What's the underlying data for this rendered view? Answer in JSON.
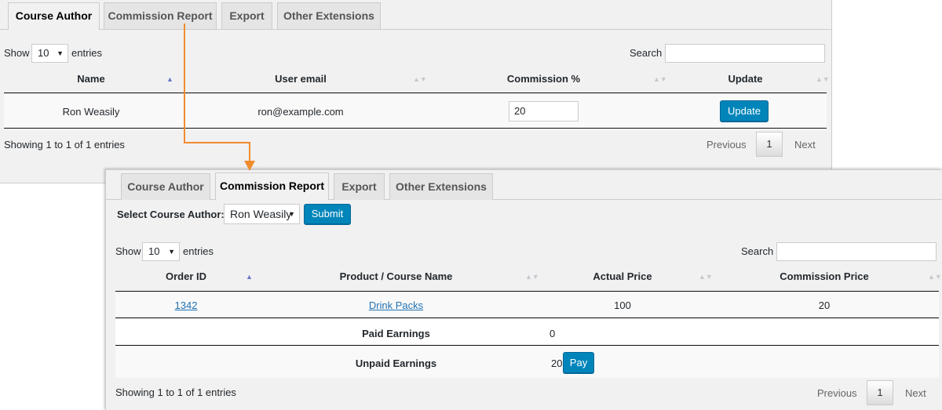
{
  "colors": {
    "accent": "#0085ba",
    "arrow": "#f08c2e",
    "link": "#2271b1"
  },
  "tabs": [
    "Course Author",
    "Commission Report",
    "Export",
    "Other Extensions"
  ],
  "panel1": {
    "active_tab": "Course Author",
    "length": {
      "show": "Show",
      "value": "10",
      "entries": "entries"
    },
    "search_label": "Search",
    "columns": [
      "Name",
      "User email",
      "Commission %",
      "Update"
    ],
    "rows": [
      {
        "name": "Ron Weasily",
        "email": "ron@example.com",
        "commission": "20",
        "update_label": "Update"
      }
    ],
    "info": "Showing 1 to 1 of 1 entries",
    "pagination": {
      "previous": "Previous",
      "current": "1",
      "next": "Next"
    }
  },
  "panel2": {
    "active_tab": "Commission Report",
    "author_label": "Select Course Author:",
    "author_value": "Ron Weasily",
    "submit_label": "Submit",
    "length": {
      "show": "Show",
      "value": "10",
      "entries": "entries"
    },
    "search_label": "Search",
    "columns": [
      "Order ID",
      "Product / Course Name",
      "Actual Price",
      "Commission Price"
    ],
    "rows": [
      {
        "order_id": "1342",
        "product": "Drink Packs",
        "actual_price": "100",
        "commission_price": "20"
      }
    ],
    "paid": {
      "label": "Paid Earnings",
      "value": "0"
    },
    "unpaid": {
      "label": "Unpaid Earnings",
      "value": "20",
      "pay_label": "Pay"
    },
    "info": "Showing 1 to 1 of 1 entries",
    "pagination": {
      "previous": "Previous",
      "current": "1",
      "next": "Next"
    }
  }
}
